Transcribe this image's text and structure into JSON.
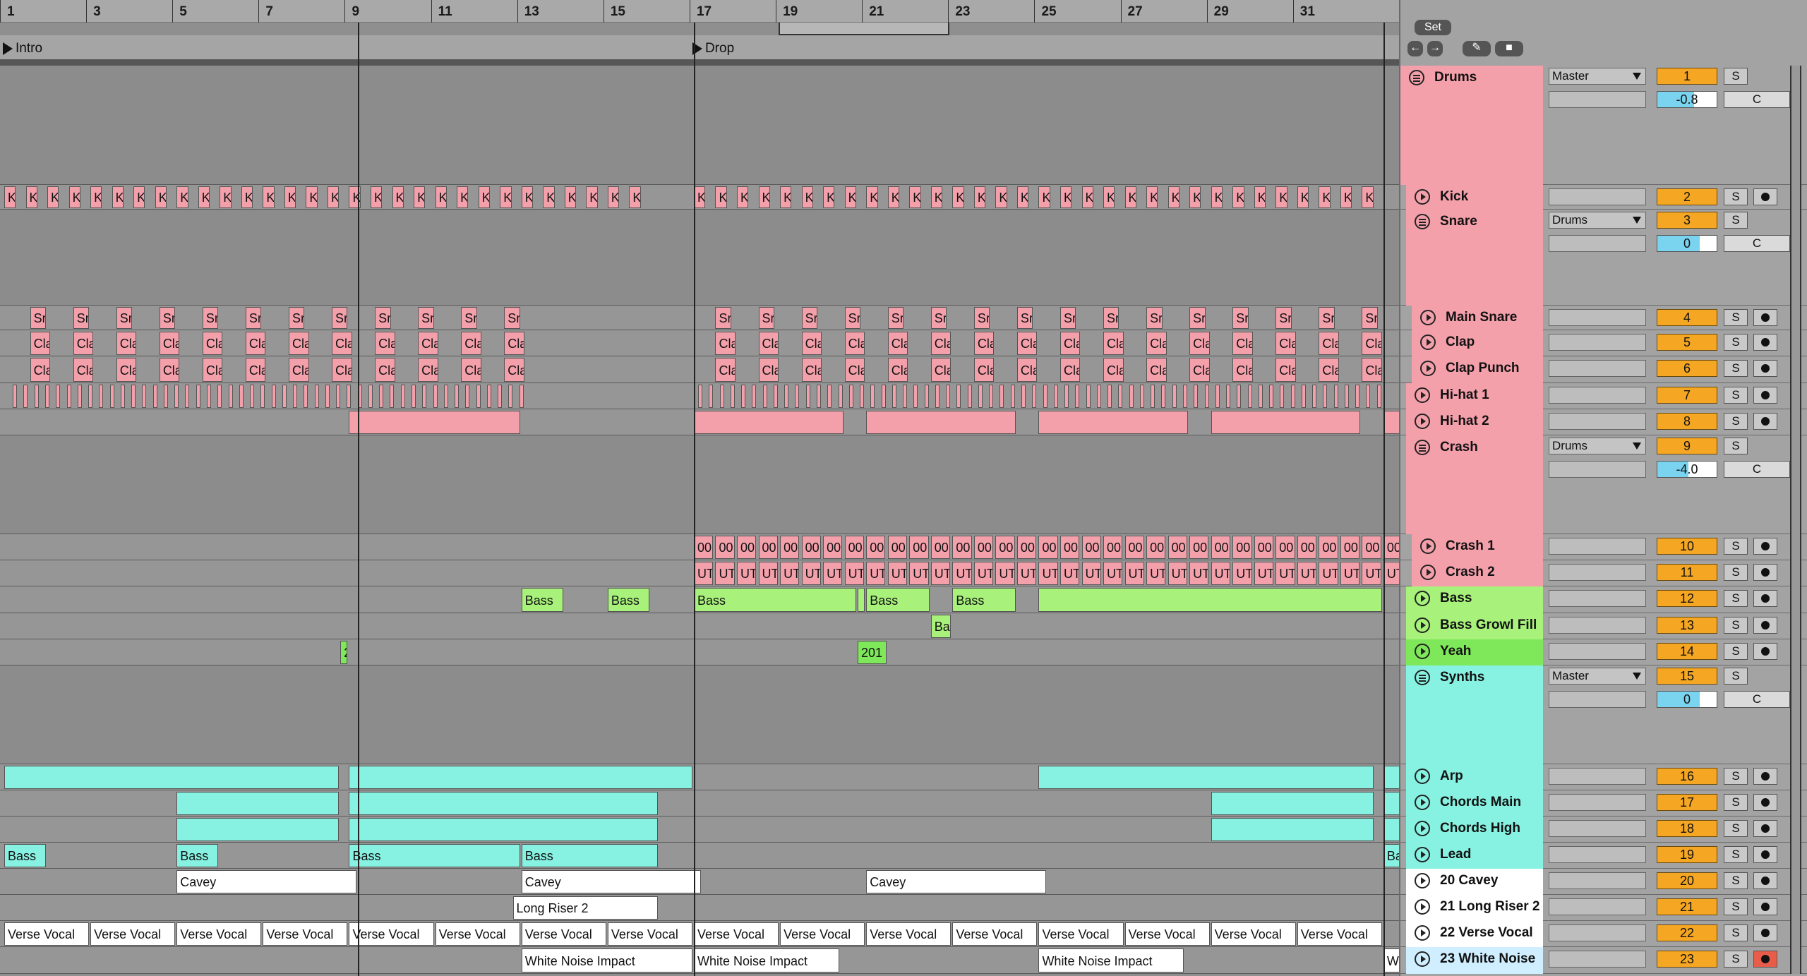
{
  "ruler": {
    "bars": [
      "1",
      "3",
      "5",
      "7",
      "9",
      "11",
      "13",
      "15",
      "17",
      "19",
      "21",
      "23",
      "25",
      "27",
      "29",
      "31"
    ]
  },
  "locators": [
    {
      "name": "Intro"
    },
    {
      "name": "Drop"
    }
  ],
  "colors": {
    "drums": "#f4a0ab",
    "bass": "#a8f27b",
    "bass_bright": "#7ee85a",
    "synths": "#87f2e2",
    "white": "#ffffff",
    "orange": "#f5a623",
    "vol_blue": "#7ad3ef",
    "arm_red": "#e85d4a"
  },
  "mixer": {
    "set_label": "Set",
    "tracks": [
      {
        "name": "Drums",
        "type": "group",
        "num": "1",
        "io": "Master",
        "vol": "-0.8",
        "vol_level": 0.62,
        "pan": "C",
        "color": "drums"
      },
      {
        "name": "Kick",
        "type": "track",
        "num": "2",
        "color": "drums"
      },
      {
        "name": "Snare",
        "type": "group",
        "num": "3",
        "io": "Drums",
        "vol": "0",
        "vol_level": 0.72,
        "pan": "C",
        "color": "drums"
      },
      {
        "name": "Main Snare",
        "type": "track",
        "num": "4",
        "color": "drums"
      },
      {
        "name": "Clap",
        "type": "track",
        "num": "5",
        "color": "drums"
      },
      {
        "name": "Clap Punch",
        "type": "track",
        "num": "6",
        "color": "drums"
      },
      {
        "name": "Hi-hat 1",
        "type": "track",
        "num": "7",
        "color": "drums"
      },
      {
        "name": "Hi-hat 2",
        "type": "track",
        "num": "8",
        "color": "drums"
      },
      {
        "name": "Crash",
        "type": "group",
        "num": "9",
        "io": "Drums",
        "vol": "-4.0",
        "vol_level": 0.52,
        "pan": "C",
        "color": "drums"
      },
      {
        "name": "Crash 1",
        "type": "track",
        "num": "10",
        "color": "drums"
      },
      {
        "name": "Crash 2",
        "type": "track",
        "num": "11",
        "color": "drums"
      },
      {
        "name": "Bass",
        "type": "track",
        "num": "12",
        "color": "bass"
      },
      {
        "name": "Bass Growl Fill",
        "type": "track",
        "num": "13",
        "color": "bass"
      },
      {
        "name": "Yeah",
        "type": "track",
        "num": "14",
        "color": "bass_bright"
      },
      {
        "name": "Synths",
        "type": "group",
        "num": "15",
        "io": "Master",
        "vol": "0",
        "vol_level": 0.72,
        "pan": "C",
        "color": "synths"
      },
      {
        "name": "Arp",
        "type": "track",
        "num": "16",
        "color": "synths"
      },
      {
        "name": "Chords Main",
        "type": "track",
        "num": "17",
        "color": "synths"
      },
      {
        "name": "Chords High",
        "type": "track",
        "num": "18",
        "color": "synths"
      },
      {
        "name": "Lead",
        "type": "track",
        "num": "19",
        "color": "synths"
      },
      {
        "name": "20 Cavey",
        "type": "track",
        "num": "20",
        "color": "white"
      },
      {
        "name": "21 Long Riser 2",
        "type": "track",
        "num": "21",
        "color": "white"
      },
      {
        "name": "22 Verse Vocal",
        "type": "track",
        "num": "22",
        "color": "white"
      },
      {
        "name": "23 White Noise",
        "type": "track",
        "num": "23",
        "color": "white",
        "armed": true
      }
    ]
  },
  "clips": {
    "kick_label": "K",
    "snare_label": "Sr",
    "clap_label": "Cla",
    "crash1_label": "00",
    "crash2_label": "UT",
    "bass_label": "Bass",
    "bass_growl_label": "Ba",
    "yeah_label": "201",
    "yeah_intro_label": "2",
    "lead_label": "Bass",
    "cavey_label": "Cavey",
    "riser_label": "Long Riser 2",
    "verse_label": "Verse Vocal",
    "noise_label": "White Noise Impact"
  }
}
